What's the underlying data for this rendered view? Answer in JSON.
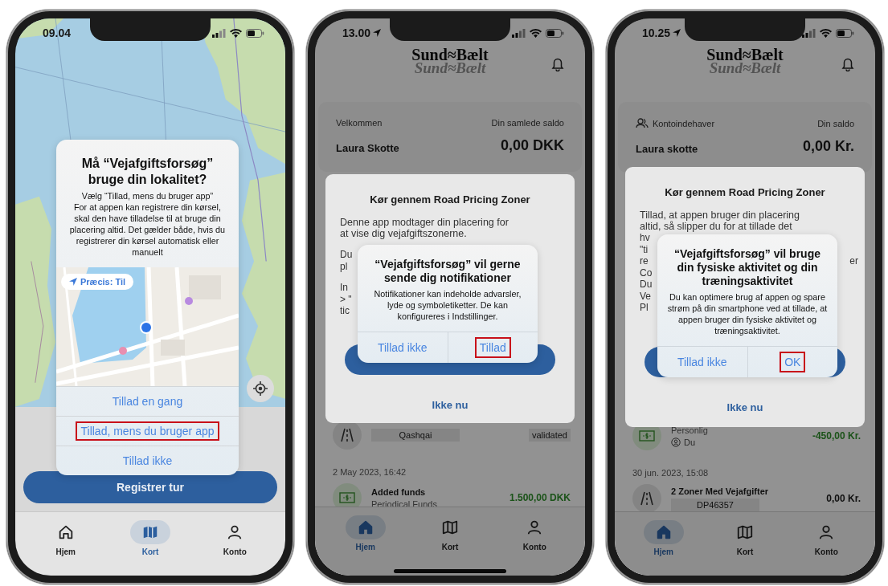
{
  "phones": [
    {
      "kind": "map",
      "status": {
        "time": "09.04",
        "location_arrow": false
      },
      "alert": {
        "kind": "stacked",
        "title": "Må “Vejafgiftsforsøg” bruge din lokalitet?",
        "message": "Vælg “Tillad, mens du bruger app”\nFor at appen kan registrere din kørsel, skal den have tilladelse til at bruge din placering altid. Det gælder både, hvis du registrerer din kørsel automatisk eller manuelt",
        "precision": "Præcis: Til",
        "buttons": [
          {
            "label": "Tillad en gang",
            "highlighted": false
          },
          {
            "label": "Tillad, mens du bruger app",
            "highlighted": true
          },
          {
            "label": "Tillad ikke",
            "highlighted": false
          }
        ]
      },
      "primary_button": "Registrer tur",
      "tabs": [
        {
          "label": "Hjem",
          "selected": false
        },
        {
          "label": "Kort",
          "selected": true
        },
        {
          "label": "Konto",
          "selected": false
        }
      ]
    },
    {
      "kind": "home",
      "status": {
        "time": "13.00",
        "location_arrow": true
      },
      "logo": "Sund≈Bælt",
      "logo_echo": "Sund≈Bælt",
      "account": {
        "left_label": "Velkommen",
        "holder_icon": false,
        "name": "Laura Skotte",
        "right_label": "Din samlede saldo",
        "balance": "0,00 DKK"
      },
      "sheet": {
        "title": "Kør gennem Road Pricing Zoner",
        "paragraph": [
          "Denne app modtager din placering for",
          "at vise dig vejafgiftszonerne."
        ],
        "fragments": [
          [
            {
              "left": "Du"
            },
            {
              "left": "pl"
            }
          ],
          [
            {
              "left": "In"
            },
            {
              "left": "> \""
            },
            {
              "left": "tic"
            }
          ]
        ],
        "secondary": "Ikke nu"
      },
      "alert": {
        "kind": "side",
        "title": "“Vejafgiftsforsøg” vil gerne sende dig notifikationer",
        "message": "Notifikationer kan indeholde advarsler, lyde og symboletiketter. De kan konfigureres i Indstillinger.",
        "buttons": [
          {
            "label": "Tillad ikke",
            "highlighted": false
          },
          {
            "label": "Tillad",
            "highlighted": true
          }
        ]
      },
      "feed": [
        {
          "kind": "toll",
          "tag": "Qashqai",
          "status": "validated"
        },
        {
          "kind": "date",
          "text": "2 May 2023, 16:42"
        },
        {
          "kind": "funds",
          "title": "Added funds",
          "subtitle": "Periodical Funds",
          "amount": "1.500,00 DKK"
        }
      ],
      "tabs": [
        {
          "label": "Hjem",
          "selected": true
        },
        {
          "label": "Kort",
          "selected": false
        },
        {
          "label": "Konto",
          "selected": false
        }
      ],
      "home_indicator": true
    },
    {
      "kind": "home",
      "status": {
        "time": "10.25",
        "location_arrow": true
      },
      "logo": "Sund≈Bælt",
      "logo_echo": "Sund≈Bælt",
      "account": {
        "left_label": "Kontoindehaver",
        "holder_icon": true,
        "name": "Laura skotte",
        "right_label": "Din saldo",
        "balance": "0,00 Kr."
      },
      "sheet": {
        "title": "Kør gennem Road Pricing Zoner",
        "paragraph": [
          "Tillad, at appen bruger din placering",
          "altid, så slipper du for at tillade det"
        ],
        "fragments": [
          [
            {
              "left": "hv"
            },
            {
              "left": "\"ti"
            },
            {
              "left": "re",
              "right": "er"
            },
            {
              "left": "Co"
            }
          ],
          [
            {
              "left": "Du"
            },
            {
              "left": "Ve"
            },
            {
              "left": "Pl"
            }
          ]
        ],
        "secondary": "Ikke nu"
      },
      "alert": {
        "kind": "side",
        "title": "“Vejafgiftsforsøg” vil bruge din fysiske aktivitet og din træningsaktivitet",
        "message": "Du kan optimere brug af appen og spare strøm på din smartphone ved at tillade, at appen bruger din fysiske aktivitet og træningsaktivitet.",
        "buttons": [
          {
            "label": "Tillad ikke",
            "highlighted": false
          },
          {
            "label": "OK",
            "highlighted": true
          }
        ]
      },
      "feed": [
        {
          "kind": "funds",
          "subtitle": "Personlig",
          "person": "Du",
          "amount": "-450,00 Kr."
        },
        {
          "kind": "date",
          "text": "30 jun. 2023, 15:08"
        },
        {
          "kind": "toll",
          "title": "2 Zoner Med Vejafgifter",
          "tag": "DP46357",
          "amount": "0,00 Kr."
        }
      ],
      "tabs": [
        {
          "label": "Hjem",
          "selected": true
        },
        {
          "label": "Kort",
          "selected": false
        },
        {
          "label": "Konto",
          "selected": false
        }
      ]
    }
  ]
}
